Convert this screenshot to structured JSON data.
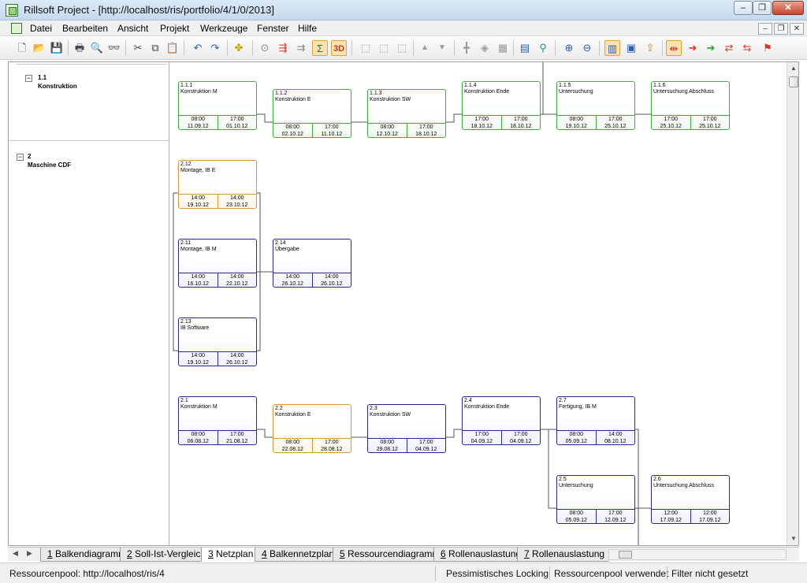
{
  "window": {
    "title": "Rillsoft Project - [http://localhost/ris/portfolio/4/1/0/2013]",
    "min_glyph": "–",
    "max_glyph": "❐",
    "close_glyph": "✕"
  },
  "menu": {
    "items": [
      "Datei",
      "Bearbeiten",
      "Ansicht",
      "Projekt",
      "Werkzeuge",
      "Fenster",
      "Hilfe"
    ],
    "mdi_min": "–",
    "mdi_restore": "❐",
    "mdi_close": "✕"
  },
  "toolbar": {
    "icons": [
      {
        "name": "new-document-icon",
        "glyph": "🗋"
      },
      {
        "name": "open-folder-icon",
        "glyph": "📂"
      },
      {
        "name": "save-icon",
        "glyph": "💾"
      },
      {
        "name": "print-icon",
        "glyph": "🖶"
      },
      {
        "name": "print-preview-icon",
        "glyph": "🔍"
      },
      {
        "name": "find-icon",
        "glyph": "👓"
      },
      {
        "name": "cut-icon",
        "glyph": "✂"
      },
      {
        "name": "copy-icon",
        "glyph": "⧉"
      },
      {
        "name": "paste-icon",
        "glyph": "📋"
      },
      {
        "name": "undo-icon",
        "glyph": "↶"
      },
      {
        "name": "redo-icon",
        "glyph": "↷"
      },
      {
        "name": "puzzle-icon",
        "glyph": "✤"
      },
      {
        "name": "timeline-icon",
        "glyph": "⊙"
      },
      {
        "name": "critical-path-icon",
        "glyph": "⇶"
      },
      {
        "name": "schedule-icon",
        "glyph": "⇉"
      },
      {
        "name": "sigma-icon",
        "glyph": "Σ"
      },
      {
        "name": "3d-icon",
        "glyph": "3D"
      },
      {
        "name": "link-finish-start-icon",
        "glyph": "⬚"
      },
      {
        "name": "link-start-start-icon",
        "glyph": "⬚"
      },
      {
        "name": "link-finish-finish-icon",
        "glyph": "⬚"
      },
      {
        "name": "move-up-icon",
        "glyph": "▲"
      },
      {
        "name": "move-down-icon",
        "glyph": "▼"
      },
      {
        "name": "add-task-icon",
        "glyph": "╋"
      },
      {
        "name": "add-milestone-icon",
        "glyph": "◈"
      },
      {
        "name": "add-subtask-icon",
        "glyph": "▦"
      },
      {
        "name": "outline-icon",
        "glyph": "▤"
      },
      {
        "name": "filter-icon",
        "glyph": "⚲"
      },
      {
        "name": "zoom-in-icon",
        "glyph": "⊕"
      },
      {
        "name": "zoom-out-icon",
        "glyph": "⊖"
      },
      {
        "name": "layout-network-icon",
        "glyph": "▥"
      },
      {
        "name": "layout-grid-icon",
        "glyph": "▣"
      },
      {
        "name": "export-icon",
        "glyph": "⇪"
      },
      {
        "name": "align-center-icon",
        "glyph": "⇹"
      },
      {
        "name": "arrow-right-red-icon",
        "glyph": "➜"
      },
      {
        "name": "arrow-right-green-icon",
        "glyph": "➔"
      },
      {
        "name": "arrow-swap-icon",
        "glyph": "⇄"
      },
      {
        "name": "arrow-both-icon",
        "glyph": "⇆"
      },
      {
        "name": "flag-icon",
        "glyph": "⚑"
      }
    ]
  },
  "groups": [
    {
      "num": "1.1",
      "name": "Konstruktion",
      "toggle": "−"
    },
    {
      "num": "2",
      "name": "Maschine CDF",
      "toggle": "−"
    }
  ],
  "nodes": [
    {
      "id": "1.1.1",
      "name": "Konstruktion M",
      "color": "green",
      "start_time": "08:00",
      "start_date": "11.09.12",
      "end_time": "17:00",
      "end_date": "01.10.12"
    },
    {
      "id": "1.1.2",
      "name": "Konstruktion E",
      "color": "green",
      "start_time": "08:00",
      "start_date": "02.10.12",
      "end_time": "17:00",
      "end_date": "11.10.12"
    },
    {
      "id": "1.1.3",
      "name": "Konstruktion SW",
      "color": "green",
      "start_time": "08:00",
      "start_date": "12.10.12",
      "end_time": "17:00",
      "end_date": "18.10.12"
    },
    {
      "id": "1.1.4",
      "name": "Konstruktion Ende",
      "color": "green",
      "start_time": "17:00",
      "start_date": "18.10.12",
      "end_time": "17:00",
      "end_date": "18.10.12"
    },
    {
      "id": "1.1.5",
      "name": "Untersuchung",
      "color": "green",
      "start_time": "08:00",
      "start_date": "19.10.12",
      "end_time": "17:00",
      "end_date": "25.10.12"
    },
    {
      "id": "1.1.6",
      "name": "Untersuchung Abschluss",
      "color": "green",
      "start_time": "17:00",
      "start_date": "25.10.12",
      "end_time": "17:00",
      "end_date": "25.10.12"
    },
    {
      "id": "2.12",
      "name": "Montage, IB E",
      "color": "orange",
      "start_time": "14:00",
      "start_date": "19.10.12",
      "end_time": "14:00",
      "end_date": "23.10.12"
    },
    {
      "id": "2.11",
      "name": "Montage, IB M",
      "color": "blue",
      "start_time": "14:00",
      "start_date": "16.10.12",
      "end_time": "14:00",
      "end_date": "22.10.12"
    },
    {
      "id": "2.14",
      "name": "Übergabe",
      "color": "blue",
      "start_time": "14:00",
      "start_date": "26.10.12",
      "end_time": "14:00",
      "end_date": "26.10.12"
    },
    {
      "id": "2.13",
      "name": "IB Software",
      "color": "blue",
      "start_time": "14:00",
      "start_date": "19.10.12",
      "end_time": "14:00",
      "end_date": "26.10.12"
    },
    {
      "id": "2.1",
      "name": "Konstruktion M",
      "color": "blue",
      "start_time": "08:00",
      "start_date": "06.08.12",
      "end_time": "17:00",
      "end_date": "21.08.12"
    },
    {
      "id": "2.2",
      "name": "Konstruktion E",
      "color": "orange",
      "start_time": "08:00",
      "start_date": "22.08.12",
      "end_time": "17:00",
      "end_date": "28.08.12"
    },
    {
      "id": "2.3",
      "name": "Konstruktion SW",
      "color": "blue",
      "start_time": "08:00",
      "start_date": "29.08.12",
      "end_time": "17:00",
      "end_date": "04.09.12"
    },
    {
      "id": "2.4",
      "name": "Konstruktion Ende",
      "color": "blue",
      "start_time": "17:00",
      "start_date": "04.09.12",
      "end_time": "17:00",
      "end_date": "04.09.12"
    },
    {
      "id": "2.7",
      "name": "Fertigung, IB M",
      "color": "blue",
      "start_time": "08:00",
      "start_date": "05.09.12",
      "end_time": "14:00",
      "end_date": "08.10.12"
    },
    {
      "id": "2.5",
      "name": "Untersuchung",
      "color": "blue",
      "start_time": "08:00",
      "start_date": "05.09.12",
      "end_time": "17:00",
      "end_date": "12.09.12"
    },
    {
      "id": "2.6",
      "name": "Untersuchung Abschluss",
      "color": "blue",
      "start_time": "12:00",
      "start_date": "17.09.12",
      "end_time": "12:00",
      "end_date": "17.09.12"
    }
  ],
  "tabs": [
    {
      "num": "1",
      "label": "Balkendiagramm"
    },
    {
      "num": "2",
      "label": "Soll-Ist-Vergleich"
    },
    {
      "num": "3",
      "label": "Netzplan"
    },
    {
      "num": "4",
      "label": "Balkennetzplan"
    },
    {
      "num": "5",
      "label": "Ressourcendiagramm"
    },
    {
      "num": "6",
      "label": "Rollenauslastung"
    },
    {
      "num": "7",
      "label": "Rollenauslastung"
    }
  ],
  "active_tab": "3",
  "scroll_arrows": {
    "up": "▲",
    "down": "▼",
    "left": "◀",
    "right": "▶"
  },
  "status": {
    "pool": "Ressourcenpool: http://localhost/ris/4",
    "locking": "Pessimistisches Locking",
    "pool_used": "Ressourcenpool verwendet",
    "filter": "Filter nicht gesetzt"
  }
}
